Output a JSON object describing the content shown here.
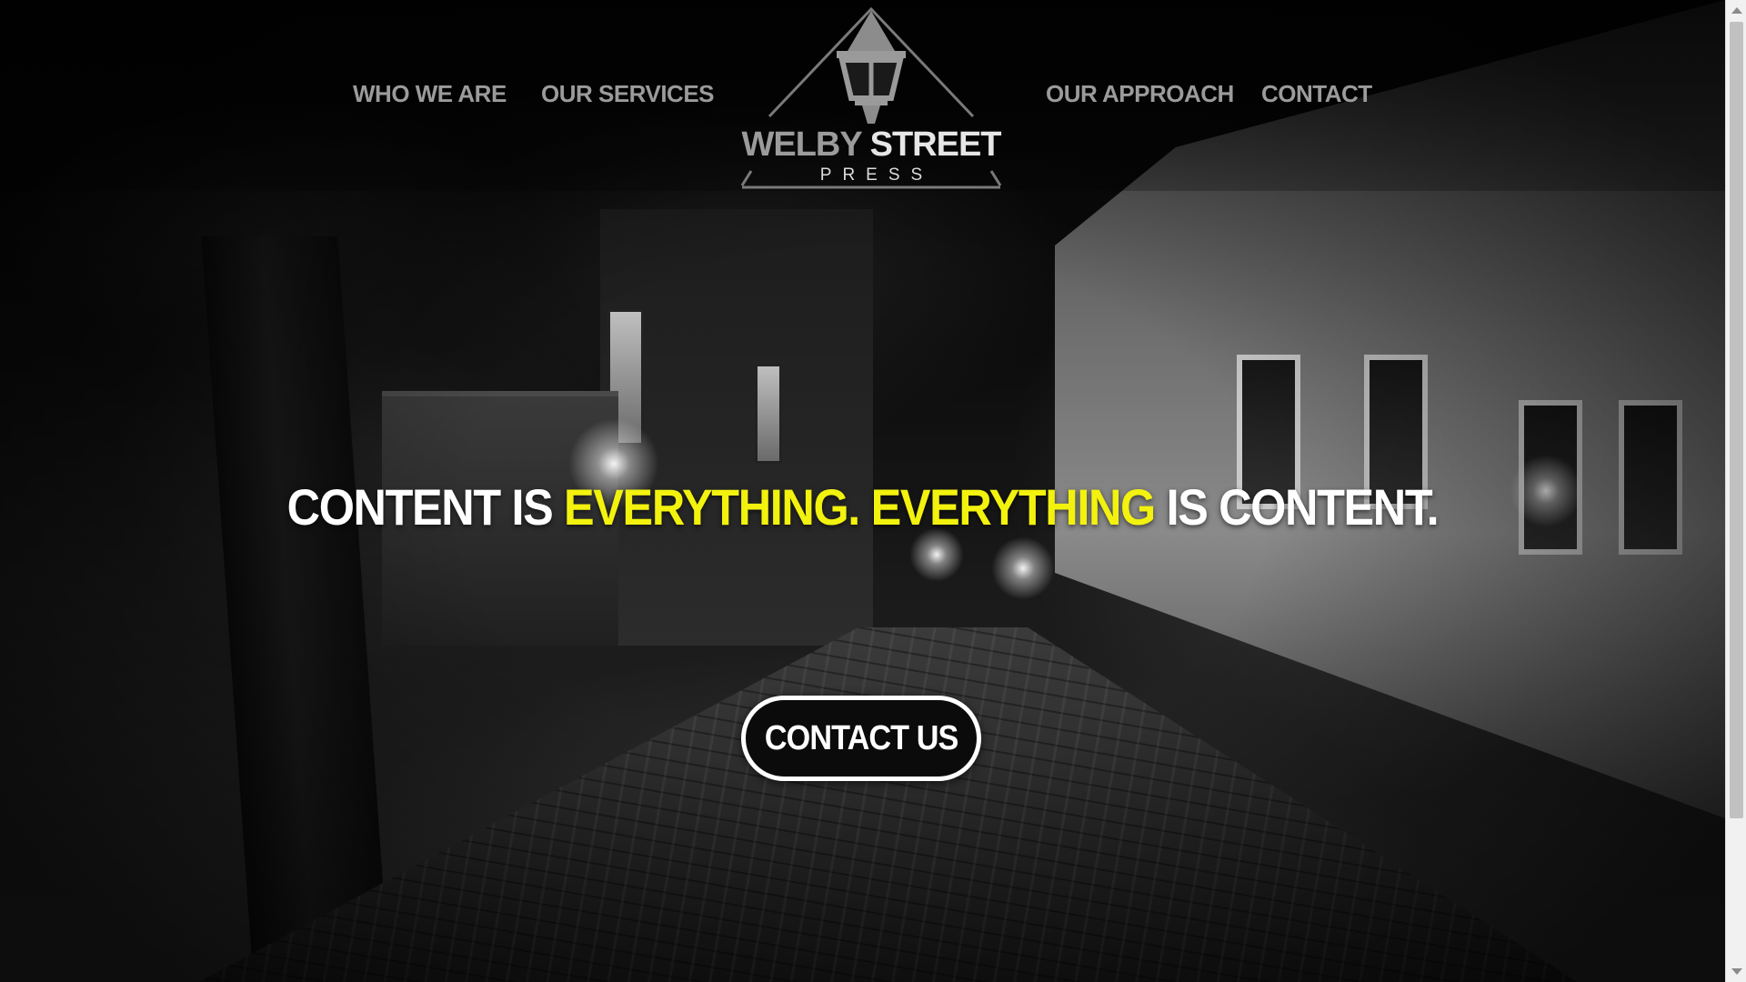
{
  "nav": {
    "left": [
      "WHO WE ARE",
      "OUR SERVICES"
    ],
    "right": [
      "OUR APPROACH",
      "CONTACT"
    ]
  },
  "logo": {
    "word1": "WELBY",
    "word2": "STREET",
    "sub": "PRESS",
    "icon": "street-lamp-icon"
  },
  "hero": {
    "headline_part1": "CONTENT IS ",
    "headline_highlight1": "EVERYTHING.",
    "headline_space": " ",
    "headline_highlight2": "EVERYTHING",
    "headline_part2": " IS CONTENT.",
    "cta_label": "CONTACT US"
  },
  "colors": {
    "accent": "#f2f20e",
    "nav_text": "#9b9b9b",
    "text": "#ffffff",
    "button_bg": "#0b0b0b"
  }
}
